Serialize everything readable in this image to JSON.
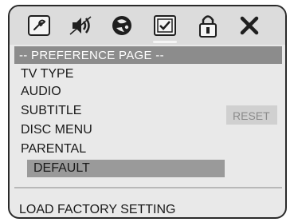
{
  "tabs": [
    {
      "icon": "wrench-icon",
      "label": "general setup"
    },
    {
      "icon": "speaker-icon",
      "label": "audio setup"
    },
    {
      "icon": "color-palette-icon",
      "label": "video setup"
    },
    {
      "icon": "checkbox-icon",
      "label": "preference page",
      "active": true
    },
    {
      "icon": "lock-icon",
      "label": "password setup"
    },
    {
      "icon": "close-icon",
      "label": "exit"
    }
  ],
  "header": {
    "title": "-- PREFERENCE PAGE --"
  },
  "menu": {
    "items": [
      {
        "label": "TV TYPE"
      },
      {
        "label": "AUDIO"
      },
      {
        "label": "SUBTITLE"
      },
      {
        "label": "DISC MENU"
      },
      {
        "label": "PARENTAL"
      },
      {
        "label": "DEFAULT",
        "selected": true
      }
    ],
    "submenu_option": "RESET"
  },
  "status": {
    "text": "LOAD FACTORY SETTING"
  },
  "colors": {
    "frame": "#2a2a2a",
    "background": "#e9e9e9",
    "header_bar": "#8c8c8c",
    "selection": "#9a9a9a"
  }
}
